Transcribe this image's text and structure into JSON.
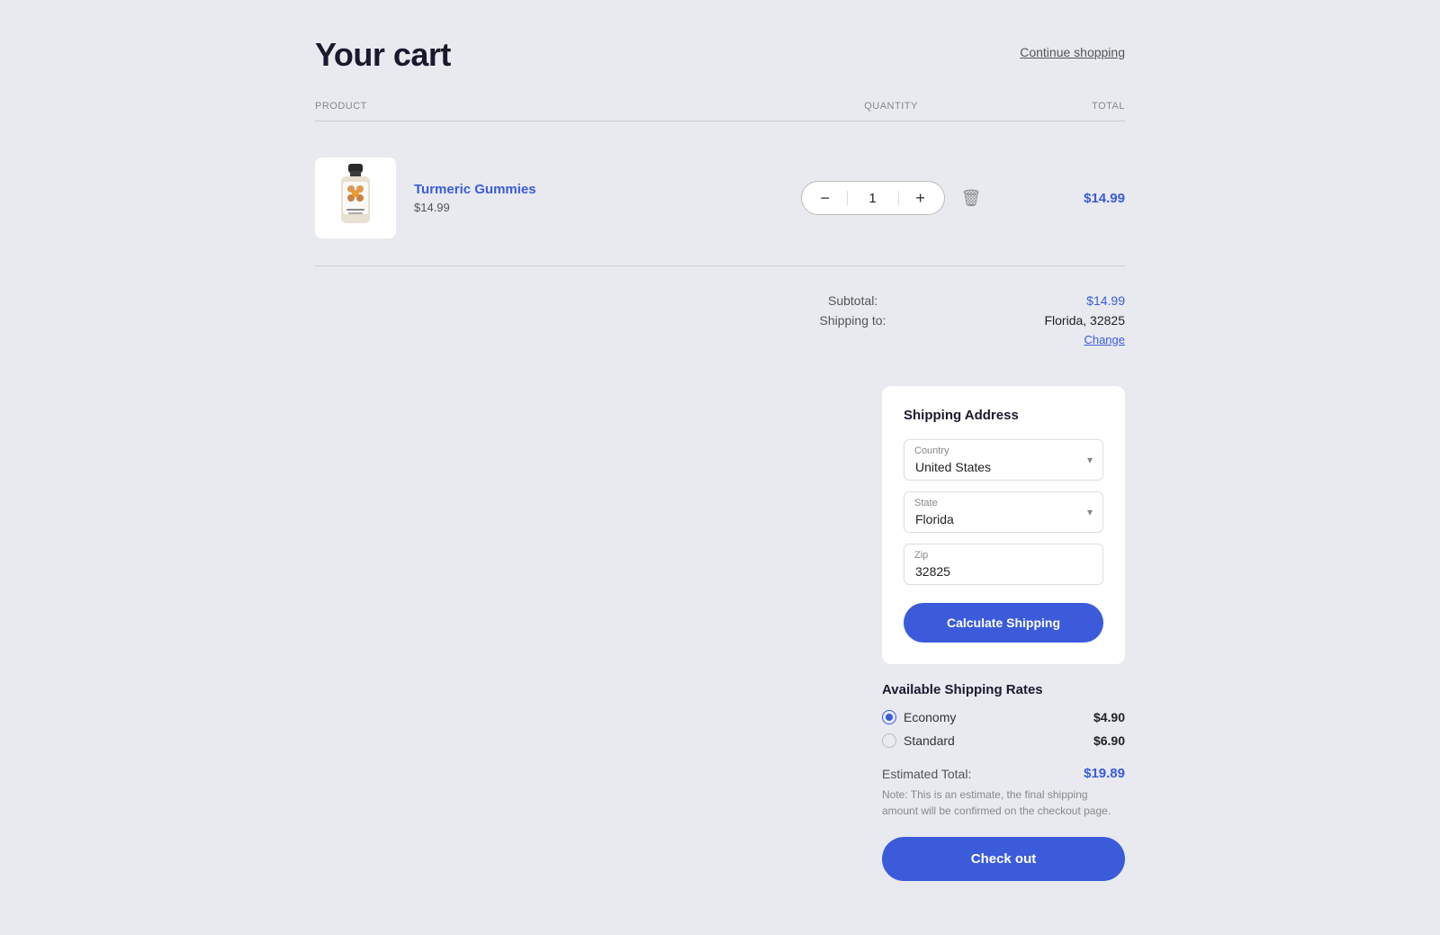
{
  "page": {
    "title": "Your cart",
    "continue_shopping": "Continue shopping"
  },
  "table": {
    "col_product": "PRODUCT",
    "col_quantity": "QUANTITY",
    "col_total": "TOTAL"
  },
  "cart_item": {
    "name": "Turmeric Gummies",
    "price": "$14.99",
    "quantity": 1,
    "total": "$14.99"
  },
  "summary": {
    "subtotal_label": "Subtotal:",
    "subtotal_value": "$14.99",
    "shipping_label": "Shipping to:",
    "shipping_location": "Florida, 32825",
    "change_label": "Change"
  },
  "shipping_address": {
    "title": "Shipping Address",
    "country_label": "Country",
    "country_value": "United States",
    "state_label": "State",
    "state_value": "Florida",
    "zip_label": "Zip",
    "zip_value": "32825",
    "calculate_btn": "Calculate Shipping"
  },
  "shipping_rates": {
    "title": "Available Shipping Rates",
    "rates": [
      {
        "id": "economy",
        "name": "Economy",
        "price": "$4.90",
        "selected": true
      },
      {
        "id": "standard",
        "name": "Standard",
        "price": "$6.90",
        "selected": false
      }
    ]
  },
  "checkout": {
    "estimated_total_label": "Estimated Total:",
    "estimated_total_value": "$19.89",
    "note": "Note: This is an estimate, the final shipping amount will be confirmed on the checkout page.",
    "checkout_btn": "Check out"
  },
  "icons": {
    "minus": "−",
    "plus": "+",
    "delete": "🗑",
    "chevron": "▾"
  }
}
